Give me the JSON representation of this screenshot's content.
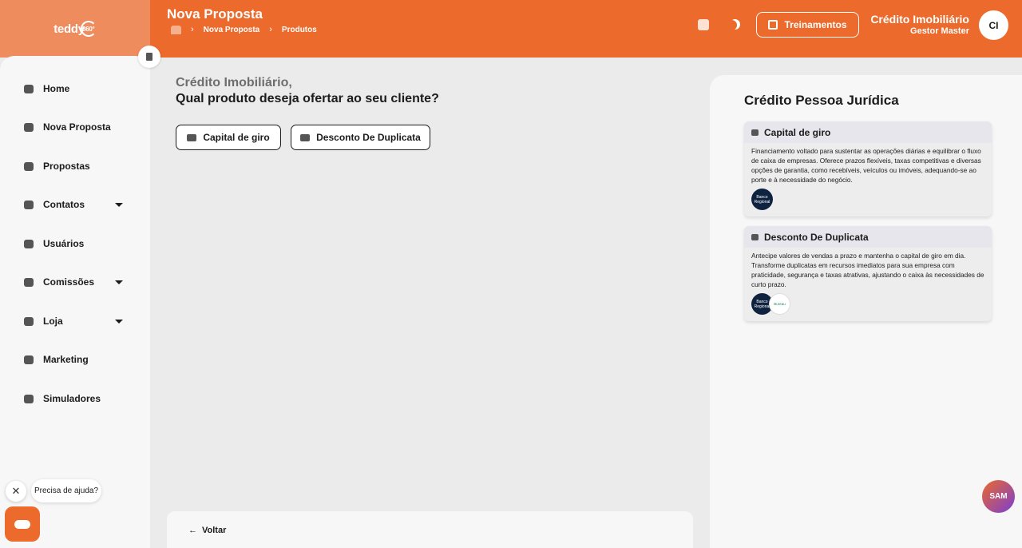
{
  "header": {
    "logo_text": "teddy",
    "logo_suffix": "360°",
    "title": "Nova Proposta",
    "breadcrumb": [
      "Nova Proposta",
      "Produtos"
    ],
    "training_button": "Treinamentos",
    "user_name": "Crédito Imobiliário",
    "user_role": "Gestor Master",
    "avatar_initials": "CI"
  },
  "sidebar": {
    "items": [
      {
        "label": "Home",
        "icon": "home-icon"
      },
      {
        "label": "Nova Proposta",
        "icon": "new-proposal-icon"
      },
      {
        "label": "Propostas",
        "icon": "proposals-icon"
      },
      {
        "label": "Contatos",
        "icon": "contacts-icon"
      },
      {
        "label": "Usuários",
        "icon": "users-icon"
      },
      {
        "label": "Comissões",
        "icon": "commissions-icon"
      },
      {
        "label": "Loja",
        "icon": "store-icon"
      },
      {
        "label": "Marketing",
        "icon": "marketing-icon"
      },
      {
        "label": "Simuladores",
        "icon": "simulators-icon"
      }
    ],
    "help_text": "Precisa de ajuda?"
  },
  "main": {
    "subtitle": "Crédito Imobiliário,",
    "title": "Qual produto deseja ofertar ao seu cliente?",
    "products": [
      "Capital de giro",
      "Desconto De Duplicata"
    ],
    "back_label": "Voltar"
  },
  "right_panel": {
    "title": "Crédito Pessoa Jurídica",
    "cards": [
      {
        "title": "Capital de giro",
        "description": "Financiamento voltado para sustentar as operações diárias e equilibrar o fluxo de caixa de empresas. Oferece prazos flexíveis, taxas competitivas e diversas opções de garantia, como recebíveis, veículos ou imóveis, adequando-se ao porte e à necessidade do negócio.",
        "logos": [
          "Banco Regional"
        ]
      },
      {
        "title": "Desconto De Duplicata",
        "description": "Antecipe valores de vendas a prazo e mantenha o capital de giro em dia. Transforme duplicatas em recursos imediatos para sua empresa com praticidade, segurança e taxas atrativas, ajustando o caixa às necessidades de curto prazo.",
        "logos": [
          "Banco Regional",
          "Bureau"
        ]
      }
    ]
  },
  "assistant_label": "SAM"
}
